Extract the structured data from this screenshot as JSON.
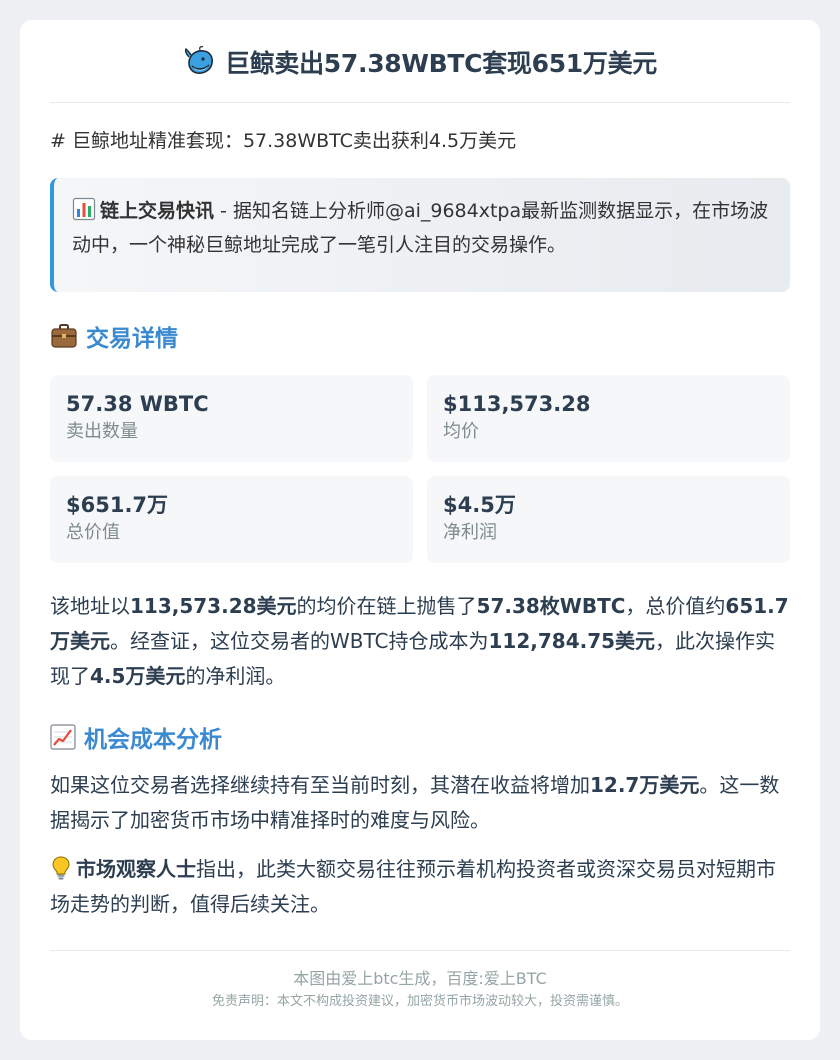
{
  "header": {
    "icon": "whale-icon",
    "title": "巨鲸卖出57.38WBTC套现651万美元"
  },
  "subtitle": "# 巨鲸地址精准套现：57.38WBTC卖出获利4.5万美元",
  "quote": {
    "icon": "bar-chart-icon",
    "strong": "链上交易快讯",
    "text": " - 据知名链上分析师@ai_9684xtpa最新监测数据显示，在市场波动中，一个神秘巨鲸地址完成了一笔引人注目的交易操作。"
  },
  "details": {
    "icon": "briefcase-icon",
    "heading": "交易详情",
    "stats": [
      {
        "value": "57.38 WBTC",
        "label": "卖出数量"
      },
      {
        "value": "$113,573.28",
        "label": "均价"
      },
      {
        "value": "$651.7万",
        "label": "总价值"
      },
      {
        "value": "$4.5万",
        "label": "净利润"
      }
    ]
  },
  "summary": {
    "t1": "该地址以",
    "b1": "113,573.28美元",
    "t2": "的均价在链上抛售了",
    "b2": "57.38枚WBTC",
    "t3": "，总价值约",
    "b3": "651.7万美元",
    "t4": "。经查证，这位交易者的WBTC持仓成本为",
    "b4": "112,784.75美元",
    "t5": "，此次操作实现了",
    "b5": "4.5万美元",
    "t6": "的净利润。"
  },
  "opportunity": {
    "icon": "chart-increasing-icon",
    "heading": "机会成本分析",
    "t1": "如果这位交易者选择继续持有至当前时刻，其潜在收益将增加",
    "b1": "12.7万美元",
    "t2": "。这一数据揭示了加密货币市场中精准择时的难度与风险。"
  },
  "observer": {
    "icon": "light-bulb-icon",
    "strong": "市场观察人士",
    "text": "指出，此类大额交易往往预示着机构投资者或资深交易员对短期市场走势的判断，值得后续关注。"
  },
  "footer": {
    "main": "本图由爱上btc生成，百度:爱上BTC",
    "note": "免责声明：本文不构成投资建议，加密货币市场波动较大，投资需谨慎。"
  }
}
